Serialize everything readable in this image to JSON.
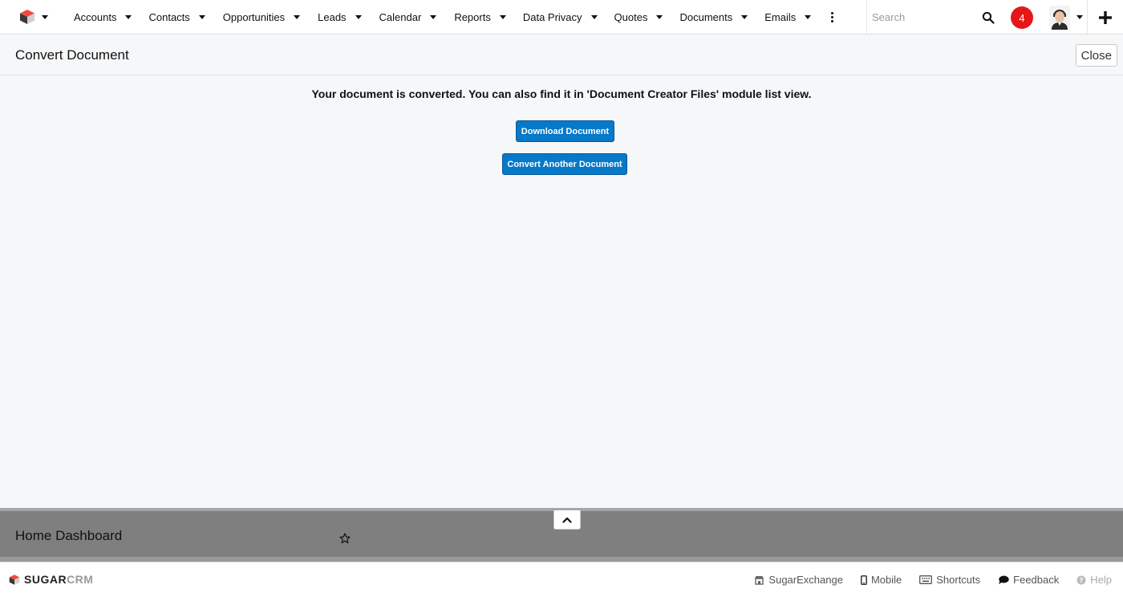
{
  "nav": {
    "items": [
      {
        "label": "Accounts"
      },
      {
        "label": "Contacts"
      },
      {
        "label": "Opportunities"
      },
      {
        "label": "Leads"
      },
      {
        "label": "Calendar"
      },
      {
        "label": "Reports"
      },
      {
        "label": "Data Privacy"
      },
      {
        "label": "Quotes"
      },
      {
        "label": "Documents"
      },
      {
        "label": "Emails"
      }
    ],
    "search_placeholder": "Search",
    "notification_count": "4"
  },
  "header": {
    "title": "Convert Document",
    "close_label": "Close"
  },
  "main": {
    "message": "Your document is converted. You can also find it in 'Document Creator Files' module list view.",
    "download_label": "Download Document",
    "convert_another_label": "Convert Another Document"
  },
  "dashboard": {
    "title": "Home Dashboard"
  },
  "footer": {
    "logo_sugar": "SUGAR",
    "logo_crm": "CRM",
    "links": {
      "exchange": "SugarExchange",
      "mobile": "Mobile",
      "shortcuts": "Shortcuts",
      "feedback": "Feedback",
      "help": "Help"
    }
  },
  "colors": {
    "primary_button": "#0679c8",
    "notification_badge": "#e61718",
    "dashboard_bar": "#7f7f7f"
  }
}
